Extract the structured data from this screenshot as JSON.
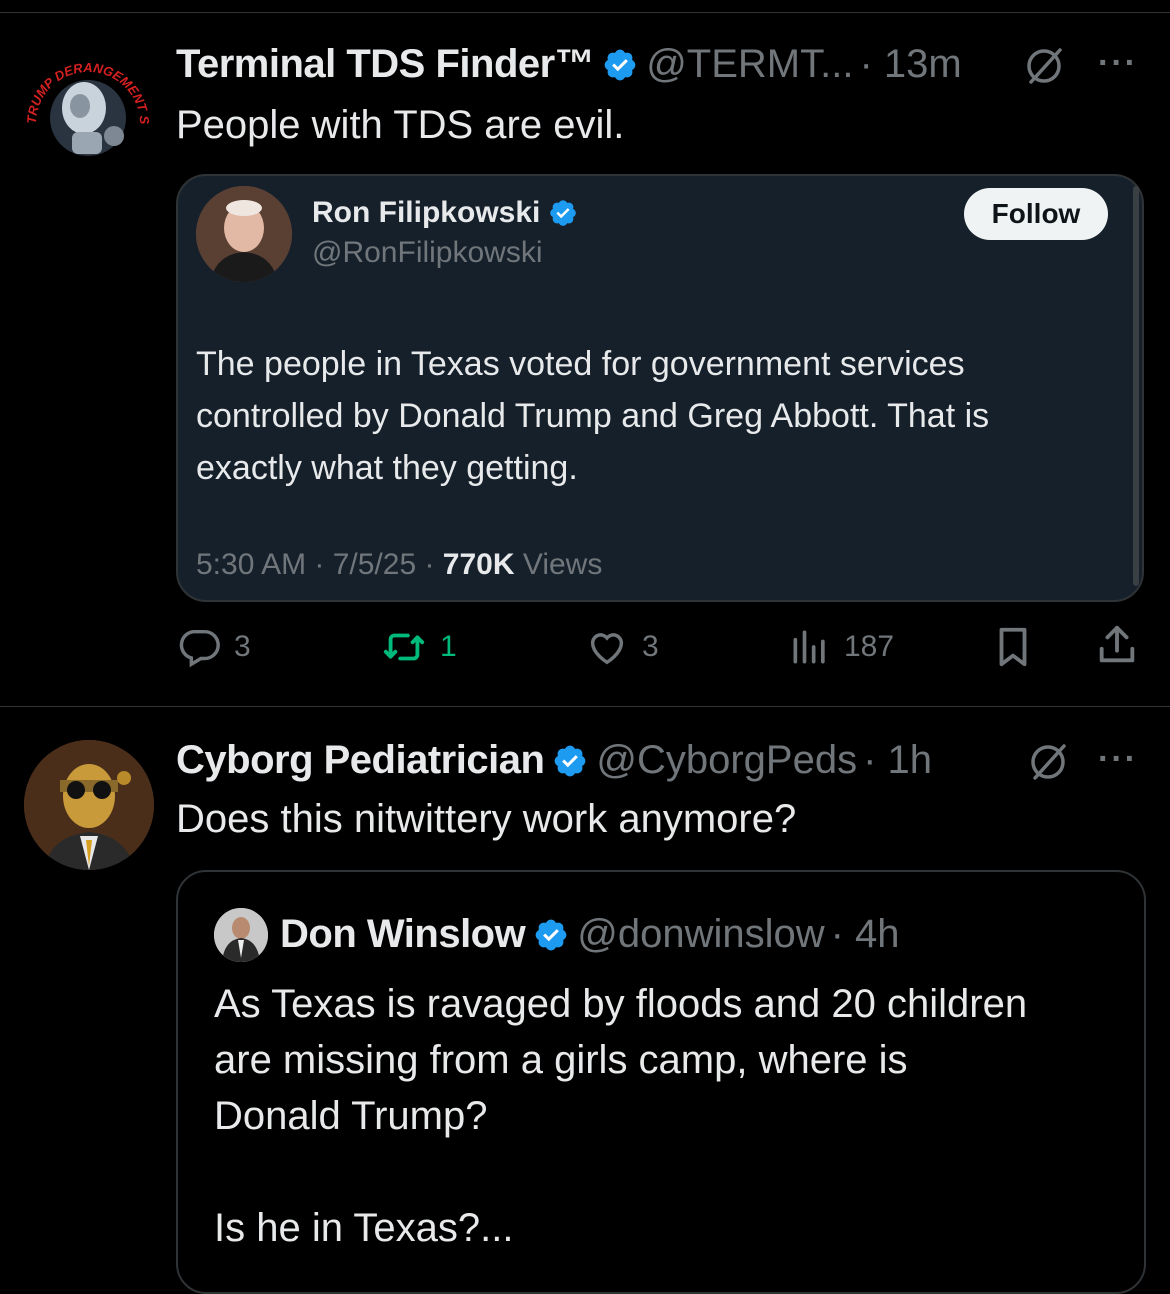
{
  "colors": {
    "verified": "#1d9bf0",
    "retweet_active": "#00ba7c",
    "muted": "#71767b",
    "quote_bg": "#15202b"
  },
  "post1": {
    "author_name": "Terminal TDS Finder™",
    "author_handle": "@TERMT...",
    "time": "· 13m",
    "avatar_arc_text": "TRUMP DERANGEMENT SYNDROME",
    "text": "People with TDS are evil.",
    "quote": {
      "author_name": "Ron Filipkowski",
      "author_handle": "@RonFilipkowski",
      "follow_label": "Follow",
      "text_lines": [
        "The people in Texas voted for government services",
        "controlled by Donald Trump and Greg Abbott. That is",
        "exactly what they getting."
      ],
      "timestamp": "5:30 AM · 7/5/25 · ",
      "views_count": "770K",
      "views_label": " Views"
    },
    "actions": {
      "replies": "3",
      "reposts": "1",
      "likes": "3",
      "views": "187"
    }
  },
  "post2": {
    "author_name": "Cyborg Pediatrician",
    "author_handle": "@CyborgPeds",
    "time": "· 1h",
    "text": "Does this nitwittery work anymore?",
    "quote": {
      "author_name": "Don Winslow",
      "author_handle": "@donwinslow",
      "time": "· 4h",
      "text_lines": [
        "As Texas is ravaged by floods and 20 children",
        "are missing from a girls camp, where is",
        "Donald Trump?"
      ],
      "text_more": "Is he in Texas?..."
    }
  },
  "icons": {
    "grok": "grok-icon",
    "more": "more-icon",
    "verified": "verified-badge-icon",
    "reply": "reply-icon",
    "repost": "repost-icon",
    "like": "like-icon",
    "views": "views-icon",
    "bookmark": "bookmark-icon",
    "share": "share-icon"
  }
}
